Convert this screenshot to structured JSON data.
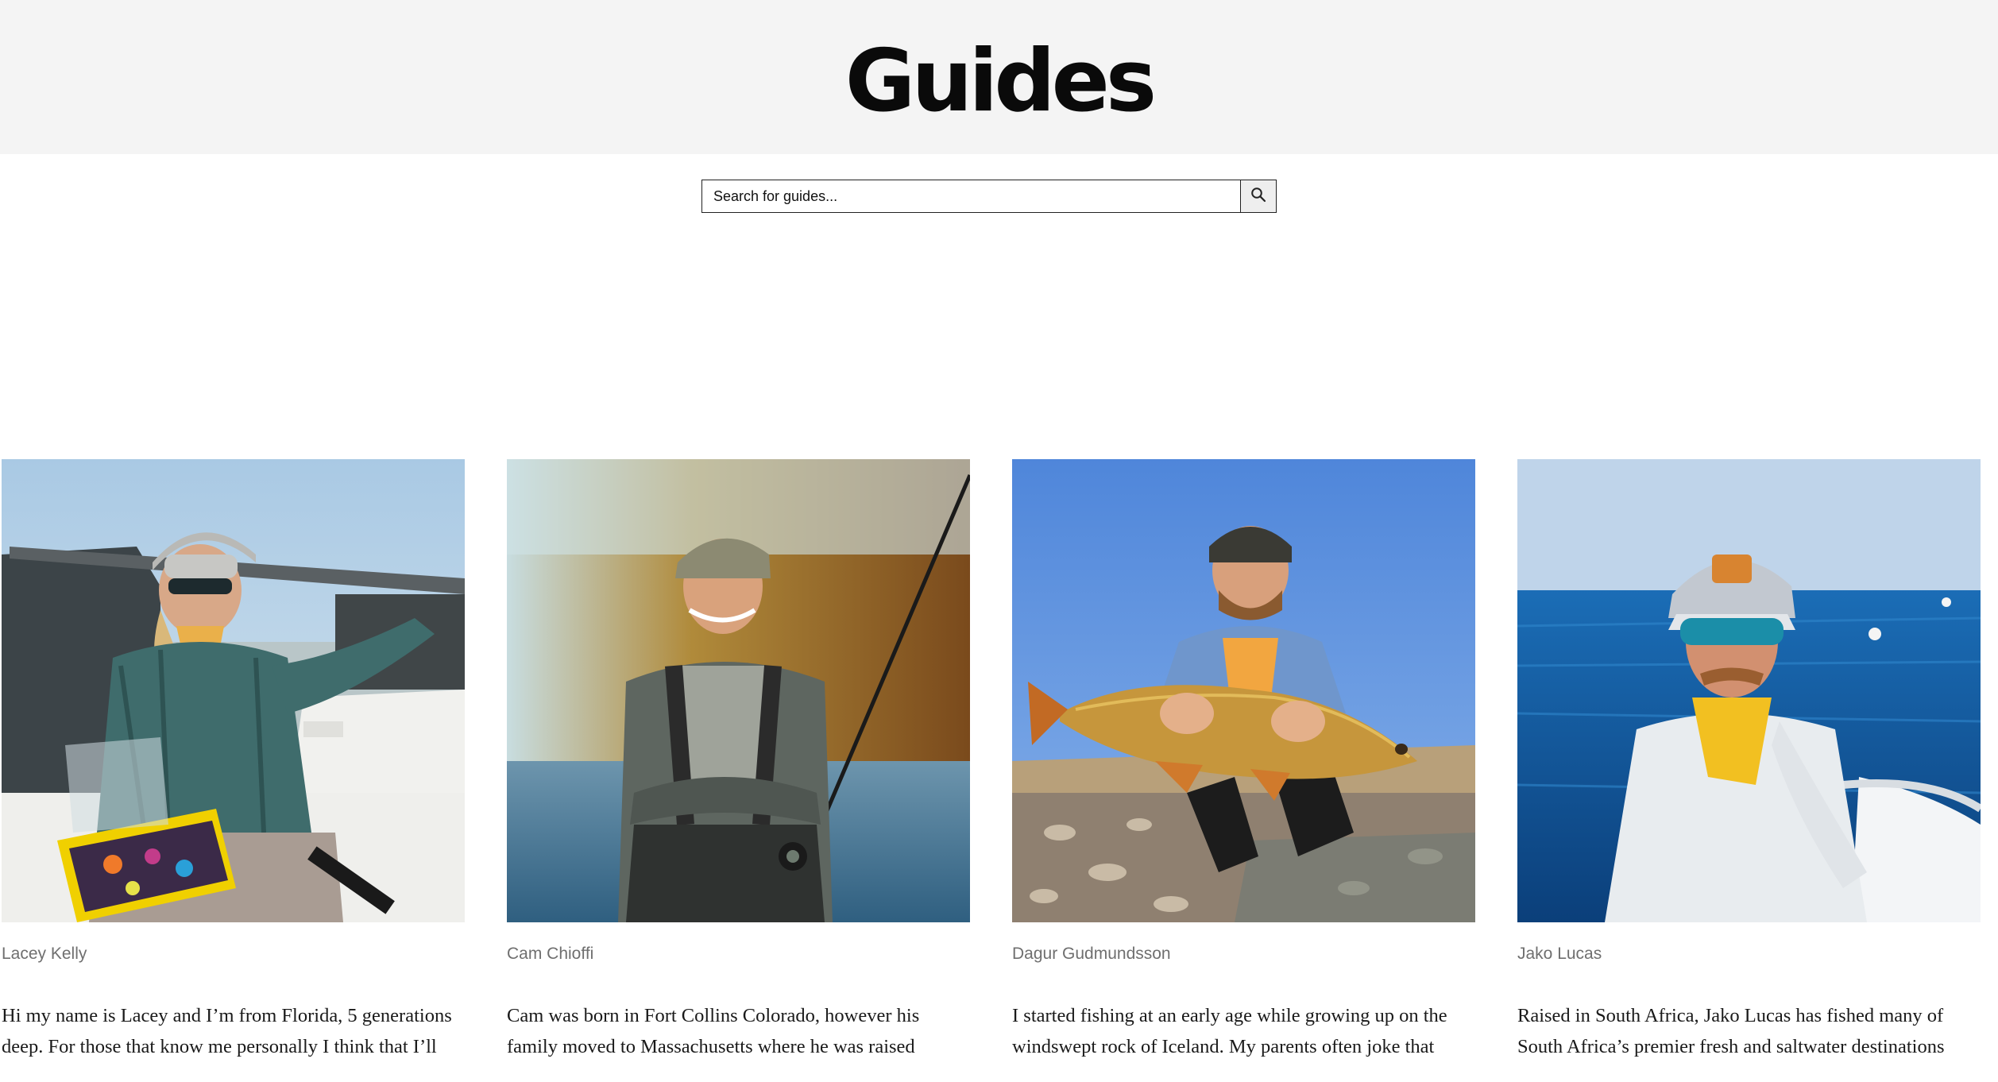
{
  "page": {
    "title": "Guides"
  },
  "search": {
    "placeholder": "Search for guides...",
    "button_icon": "search-icon"
  },
  "guides": [
    {
      "name": "Lacey Kelly",
      "bio": "Hi my name is Lacey and I’m from Florida, 5 generations deep. For those that know me personally I think that I’ll",
      "photo": "woman in cap, sunglasses, plaid shirt and yellow bandana on a boat holding a fly box"
    },
    {
      "name": "Cam Chioffi",
      "bio": "Cam was born in Fort Collins Colorado, however his family moved to Massachusetts where he was raised",
      "photo": "smiling man in camo cap and hoodie with arms crossed holding a fly rod, autumn hills behind"
    },
    {
      "name": "Dagur Gudmundsson",
      "bio": "I started fishing at an early age while growing up on the windswept rock of Iceland. My parents often joke that",
      "photo": "man kneeling at a rocky shoreline holding a large golden carp"
    },
    {
      "name": "Jako Lucas",
      "bio": "Raised in South Africa, Jako Lucas has fished many of South Africa’s premier fresh and saltwater destinations",
      "photo": "man in cap, mirrored sunglasses and yellow bandana on a boat over blue sea"
    }
  ],
  "colors": {
    "hero_bg": "#f4f4f4",
    "name_text": "#6f6f6f",
    "body_text": "#1a1a1a"
  }
}
